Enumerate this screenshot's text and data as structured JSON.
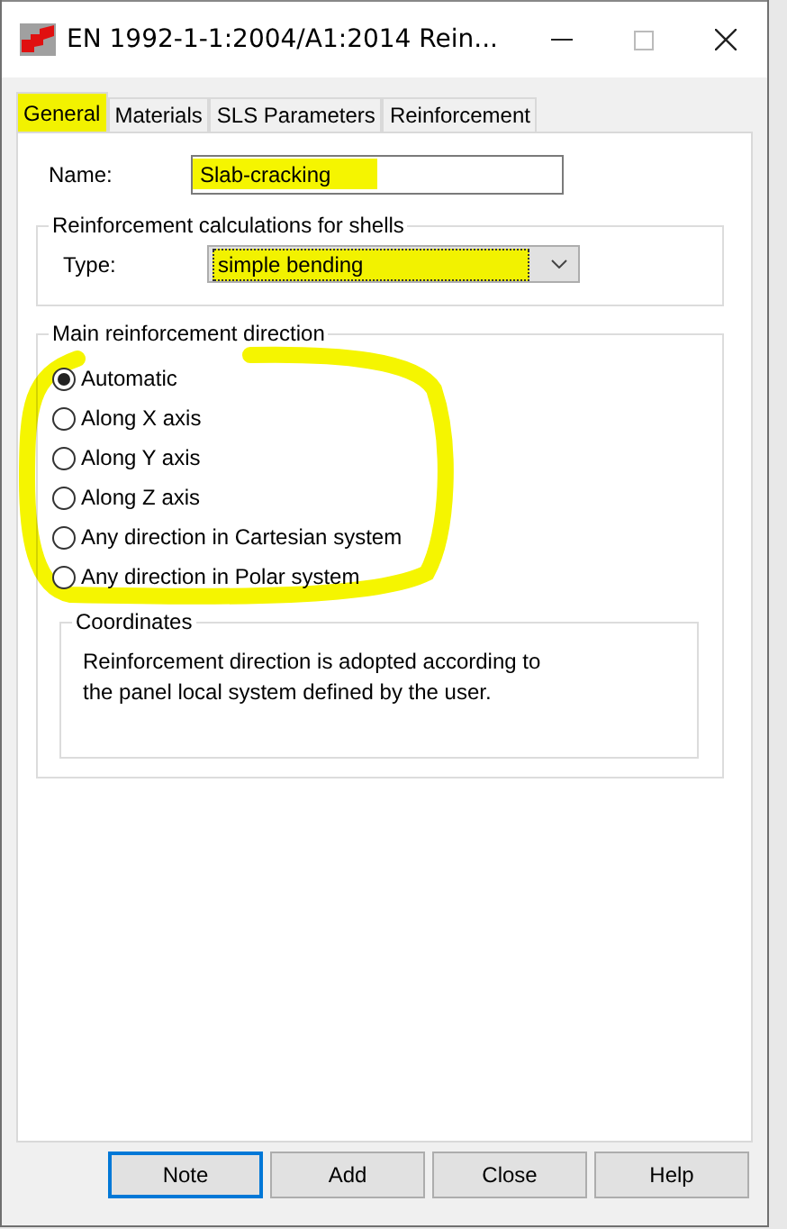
{
  "window": {
    "title": "EN 1992-1-1:2004/A1:2014 Rein..."
  },
  "tabs": [
    {
      "label": "General",
      "selected": true,
      "highlighted": true
    },
    {
      "label": "Materials",
      "selected": false,
      "highlighted": false
    },
    {
      "label": "SLS Parameters",
      "selected": false,
      "highlighted": false
    },
    {
      "label": "Reinforcement",
      "selected": false,
      "highlighted": false
    }
  ],
  "name": {
    "label": "Name:",
    "value": "Slab-cracking",
    "highlighted": true
  },
  "shell_calculations": {
    "title": "Reinforcement calculations for shells",
    "type_label": "Type:",
    "type_value": "simple bending",
    "highlighted": true
  },
  "direction": {
    "title": "Main reinforcement direction",
    "circled": true,
    "options": [
      {
        "label": "Automatic",
        "selected": true
      },
      {
        "label": "Along X axis",
        "selected": false
      },
      {
        "label": "Along Y axis",
        "selected": false
      },
      {
        "label": "Along Z axis",
        "selected": false
      },
      {
        "label": "Any direction in Cartesian system",
        "selected": false
      },
      {
        "label": "Any direction in Polar system",
        "selected": false
      }
    ],
    "coordinates": {
      "title": "Coordinates",
      "text": "Reinforcement direction is adopted according to the panel local system defined by the user."
    }
  },
  "buttons": [
    {
      "label": "Note",
      "default": true
    },
    {
      "label": "Add",
      "default": false
    },
    {
      "label": "Close",
      "default": false
    },
    {
      "label": "Help",
      "default": false
    }
  ]
}
